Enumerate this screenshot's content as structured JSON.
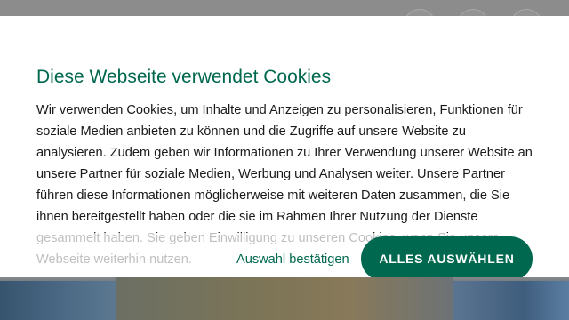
{
  "colors": {
    "accent": "#00684e",
    "overlay": "#8c8c8c",
    "dialog_bg": "#ffffff",
    "text": "#1a1a1a"
  },
  "cookie_dialog": {
    "title": "Diese Webseite verwendet Cookies",
    "body": "Wir verwenden Cookies, um Inhalte und Anzeigen zu personalisieren, Funktionen für soziale Medien anbieten zu können und die Zugriffe auf unsere Website zu analysieren. Zudem geben wir Informationen zu Ihrer Verwendung unserer Website an unsere Partner für soziale Medien, Werbung und Analysen weiter. Unsere Partner führen diese Informationen möglicherweise mit weiteren Daten zusammen, die Sie ihnen bereitgestellt haben oder die sie im Rahmen Ihrer Nutzung der Dienste gesammelt haben. Sie geben Einwilligung zu unseren Cookies, wenn Sie unsere Webseite weiterhin nutzen.",
    "select_label": "Auswahl bestätigen",
    "accept_all_label": "ALLES AUSWÄHLEN"
  },
  "header_icons": [
    "search-icon",
    "user-icon",
    "cart-icon"
  ]
}
